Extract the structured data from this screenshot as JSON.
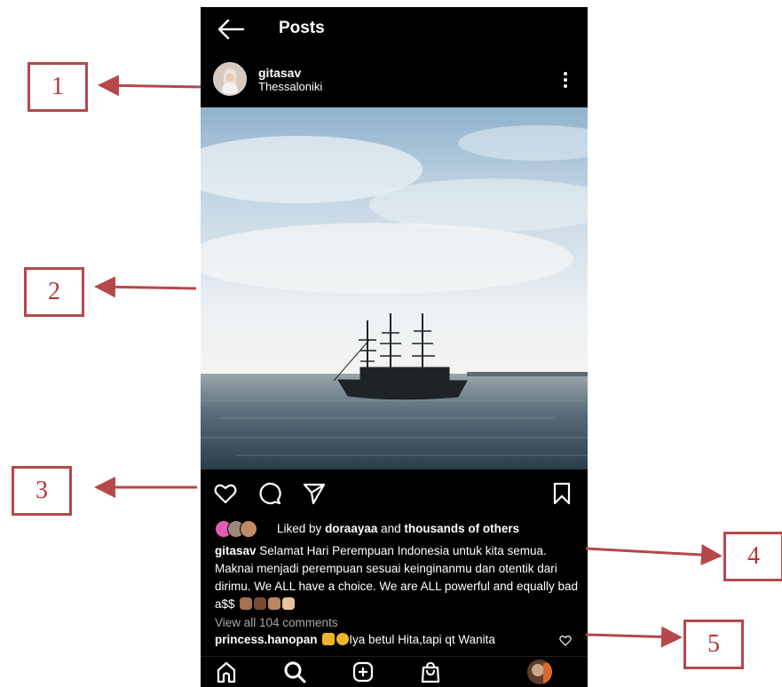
{
  "screen": {
    "title": "Posts",
    "icons": {
      "back": "arrow-left-icon",
      "more": "kebab-menu-icon",
      "like": "heart-icon",
      "comment": "comment-bubble-icon",
      "share": "paper-plane-icon",
      "save": "bookmark-icon",
      "home": "home-icon",
      "search": "search-icon",
      "create": "plus-square-icon",
      "shop": "shopping-bag-icon"
    }
  },
  "post": {
    "username": "gitasav",
    "location": "Thessaloniki",
    "likes": {
      "prefix": "Liked by",
      "user": "doraayaa",
      "and": "and",
      "others": "thousands of others"
    },
    "caption": {
      "username": "gitasav",
      "text": "Selamat Hari Perempuan Indonesia untuk kita semua. Maknai menjadi perempuan sesuai keinginanmu dan otentik dari dirimu. We ALL have a choice. We are ALL powerful and equally bad a$$"
    },
    "view_comments": "View all 104 comments",
    "comment": {
      "username": "princess.hanopan",
      "text": "Iya betul Hita,tapi qt Wanita"
    }
  },
  "annotations": [
    {
      "number": "1"
    },
    {
      "number": "2"
    },
    {
      "number": "3"
    },
    {
      "number": "4"
    },
    {
      "number": "5"
    }
  ],
  "colors": {
    "app_background": "#000000",
    "annotation": "#b5484a",
    "muted_text": "#a8a8a8"
  }
}
